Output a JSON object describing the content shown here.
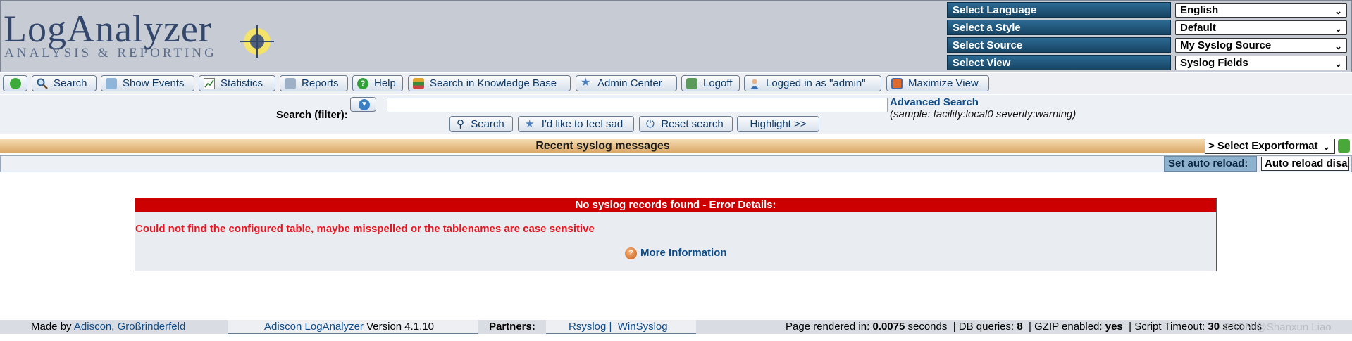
{
  "logo": {
    "main": "LogAnalyzer",
    "sub": "ANALYSIS & REPORTING"
  },
  "selectors": [
    {
      "label": "Select Language",
      "value": "English"
    },
    {
      "label": "Select a Style",
      "value": "Default"
    },
    {
      "label": "Select Source",
      "value": "My Syslog Source"
    },
    {
      "label": "Select View",
      "value": "Syslog Fields"
    }
  ],
  "toolbar": {
    "search": "Search",
    "show_events": "Show Events",
    "statistics": "Statistics",
    "reports": "Reports",
    "help": "Help",
    "knowledge_base": "Search in Knowledge Base",
    "admin_center": "Admin Center",
    "logoff": "Logoff",
    "logged_in": "Logged in as \"admin\"",
    "maximize": "Maximize View"
  },
  "search": {
    "label": "Search (filter):",
    "value": "",
    "advanced_link": "Advanced Search",
    "sample": "(sample: facility:local0 severity:warning)",
    "search_btn": "Search",
    "feel_sad_btn": "I'd like to feel sad",
    "reset_btn": "Reset search",
    "highlight_btn": "Highlight >>"
  },
  "section": {
    "title": "Recent syslog messages",
    "export_value": "> Select Exportformat",
    "reload_label": "Set auto reload:",
    "reload_value": "Auto reload disabled"
  },
  "error": {
    "title": "No syslog records found - Error Details:",
    "message": "Could not find the configured table, maybe misspelled or the tablenames are case sensitive",
    "more_info": "More Information"
  },
  "footer": {
    "made_by": "Made by",
    "adiscon": "Adiscon",
    "location": "Großrinderfeld",
    "product": "Adiscon LogAnalyzer",
    "version": "Version 4.1.10",
    "partners_label": "Partners:",
    "rsyslog": "Rsyslog",
    "winsyslog": "WinSyslog",
    "rendered_label": "Page rendered in:",
    "rendered_value": "0.0075",
    "seconds1": "seconds",
    "db_label": "DB queries:",
    "db_value": "8",
    "gzip_label": "GZIP enabled:",
    "gzip_value": "yes",
    "timeout_label": "Script Timeout:",
    "timeout_value": "30",
    "seconds2": "seconds"
  },
  "watermark": "CSDN @Shanxun Liao",
  "colors": {
    "header_bg": "#c7cbd3",
    "selector_label": "#1d5479",
    "error_red": "#cc0000",
    "title_bar": "#dba867"
  }
}
